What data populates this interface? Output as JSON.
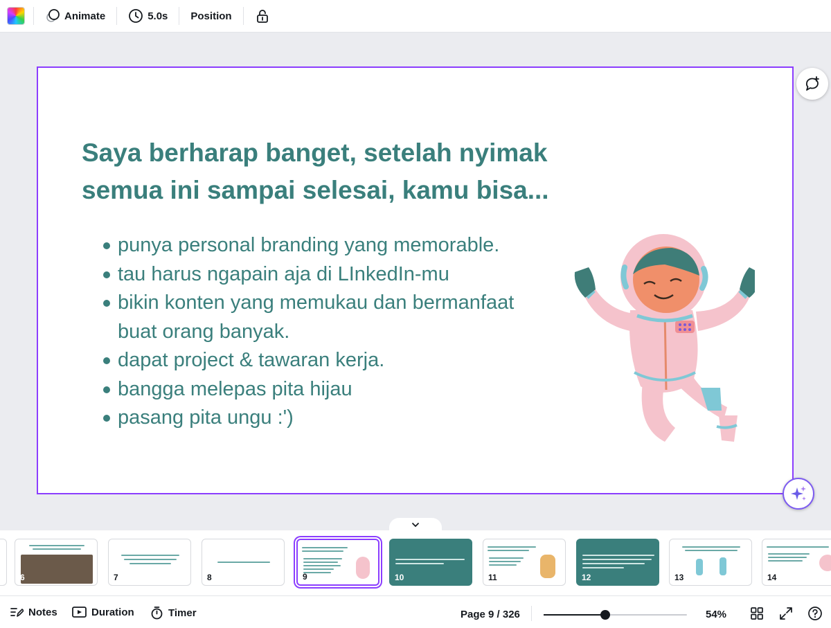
{
  "toolbar": {
    "animate_label": "Animate",
    "duration_label": "5.0s",
    "position_label": "Position"
  },
  "slide": {
    "title": "Saya berharap banget, setelah nyimak semua ini sampai selesai, kamu bisa...",
    "bullets": [
      "punya personal branding yang memorable.",
      "tau harus ngapain aja di LInkedIn-mu",
      "bikin konten yang memukau dan bermanfaat buat orang banyak.",
      "dapat project & tawaran kerja.",
      "bangga melepas pita hijau",
      "pasang pita ungu :')"
    ]
  },
  "filmstrip": {
    "thumbnails": [
      {
        "number": "6"
      },
      {
        "number": "7"
      },
      {
        "number": "8"
      },
      {
        "number": "9"
      },
      {
        "number": "10"
      },
      {
        "number": "11"
      },
      {
        "number": "12"
      },
      {
        "number": "13"
      },
      {
        "number": "14"
      }
    ],
    "current": "9"
  },
  "bottombar": {
    "notes_label": "Notes",
    "duration_label": "Duration",
    "timer_label": "Timer",
    "page_indicator": "Page 9 / 326",
    "zoom_label": "54%",
    "zoom_value": 0.43
  },
  "colors": {
    "accent": "#8b3dff",
    "slide_text": "#3a7f7c",
    "teal_slide": "#3a7f7c",
    "astronaut_suit": "#f5c3cc",
    "astronaut_trim": "#7fc8d6"
  }
}
